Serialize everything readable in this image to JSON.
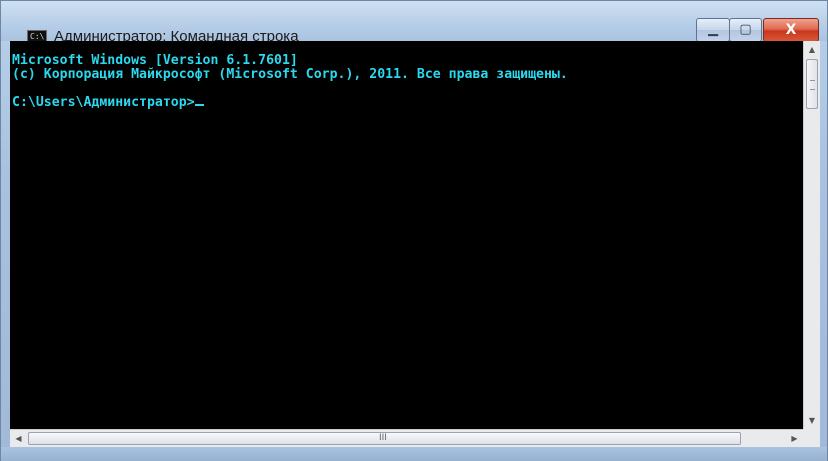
{
  "window": {
    "title": "Администратор: Командная строка",
    "icon": "cmd-icon",
    "icon_text": "C:\\"
  },
  "controls": {
    "minimize_icon": "minimize-icon",
    "maximize_icon": "maximize-icon",
    "close_icon": "close-icon",
    "minimize_glyph": "▁",
    "maximize_glyph": "▢",
    "close_glyph": "X"
  },
  "console": {
    "lines": [
      "Microsoft Windows [Version 6.1.7601]",
      "(c) Корпорация Майкрософт (Microsoft Corp.), 2011. Все права защищены.",
      "C:\\Users\\Администратор>"
    ],
    "text_color": "#2bd8ee",
    "background": "#000000"
  },
  "scrollbars": {
    "up_arrow": "▲",
    "down_arrow": "▼",
    "left_arrow": "◀",
    "right_arrow": "▶",
    "h_grip": "III"
  }
}
